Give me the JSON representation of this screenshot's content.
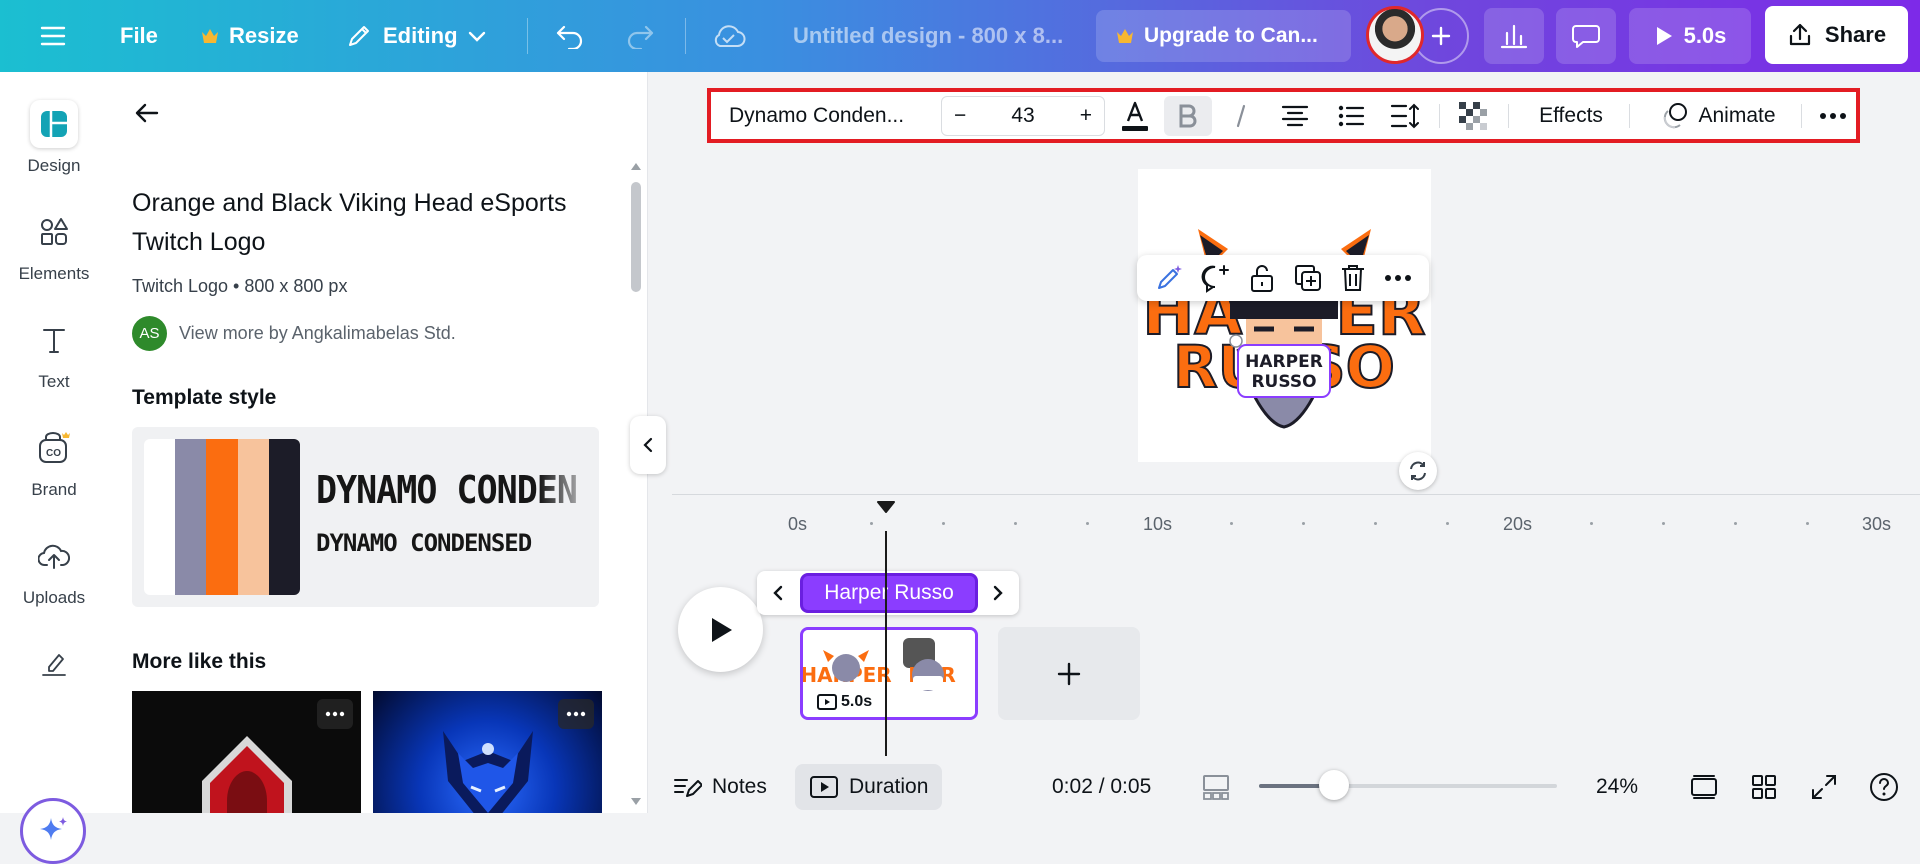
{
  "topbar": {
    "file_label": "File",
    "resize_label": "Resize",
    "editing_label": "Editing",
    "doc_title": "Untitled design - 800 x 8...",
    "upgrade_label": "Upgrade to Can...",
    "play_duration": "5.0s",
    "share_label": "Share"
  },
  "rail": {
    "items": [
      {
        "label": "Design",
        "icon": "design-icon"
      },
      {
        "label": "Elements",
        "icon": "elements-icon"
      },
      {
        "label": "Text",
        "icon": "text-icon"
      },
      {
        "label": "Brand",
        "icon": "brand-icon"
      },
      {
        "label": "Uploads",
        "icon": "uploads-icon"
      },
      {
        "label": "",
        "icon": "draw-icon"
      }
    ]
  },
  "panel": {
    "title": "Orange and Black Viking Head eSports Twitch Logo",
    "subtitle": "Twitch Logo • 800 x 800 px",
    "author_initials": "AS",
    "author_text": "View more by Angkalimabelas Std.",
    "template_style_heading": "Template style",
    "font_sample_large": "DYNAMO CONDEN",
    "font_sample_small": "DYNAMO CONDENSED",
    "more_like_heading": "More like this",
    "swatch_colors": [
      "#ffffff",
      "#8a8aa8",
      "#fb6d10",
      "#f7c39c",
      "#1c1c28"
    ]
  },
  "toolbar": {
    "font_name": "Dynamo Conden...",
    "minus": "−",
    "font_size": "43",
    "plus": "+",
    "effects_label": "Effects",
    "animate_label": "Animate"
  },
  "canvas": {
    "logo_text_line1": "HARPER",
    "logo_text_line2": "RUSSO",
    "logo_bg_line1": "HARPER",
    "logo_bg_line2": "RUSSO"
  },
  "timeline": {
    "ticks": [
      "0s",
      "10s",
      "20s",
      "30s"
    ],
    "scene_label": "Harper Russo",
    "clip_duration": "5.0s"
  },
  "bottombar": {
    "notes_label": "Notes",
    "duration_label": "Duration",
    "time_readout": "0:02 / 0:05",
    "zoom_label": "24%"
  },
  "colors": {
    "accent": "#8b3dff",
    "highlight_border": "#e31c23",
    "logo_orange": "#fb6d10"
  }
}
